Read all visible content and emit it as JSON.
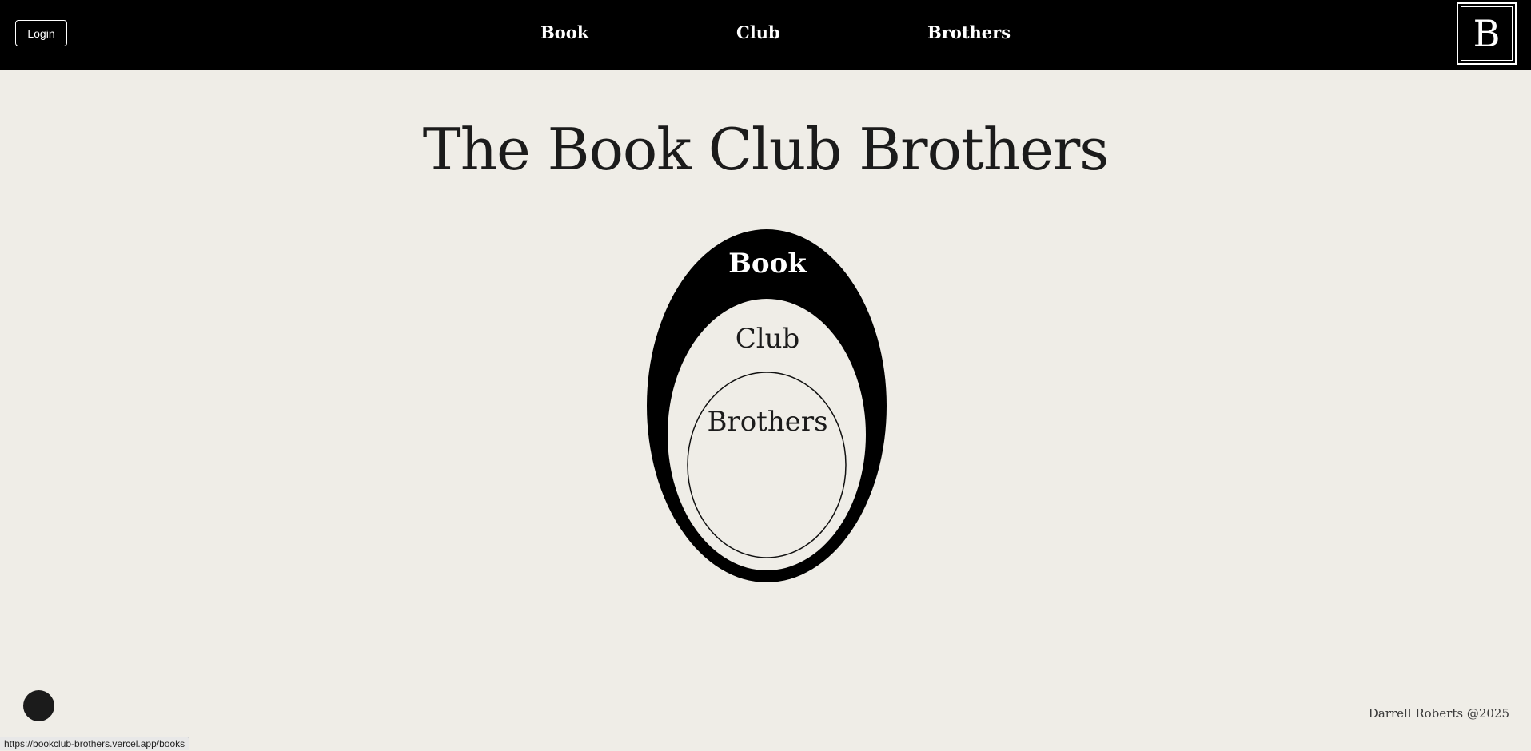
{
  "header": {
    "login_label": "Login",
    "nav": [
      {
        "label": "Book"
      },
      {
        "label": "Club"
      },
      {
        "label": "Brothers"
      }
    ],
    "logo_letter": "B"
  },
  "main": {
    "title": "The Book Club Brothers",
    "rings": {
      "outer_label": "Book",
      "middle_label": "Club",
      "inner_label": "Brothers"
    }
  },
  "footer": {
    "credit": "Darrell Roberts @2025"
  },
  "status_bar": {
    "url": "https://bookclub-brothers.vercel.app/books"
  },
  "colors": {
    "topbar": "#000000",
    "background": "#efede7",
    "text_dark": "#1b1b1b"
  },
  "icons": {
    "chat": "chat-bubble-icon"
  }
}
